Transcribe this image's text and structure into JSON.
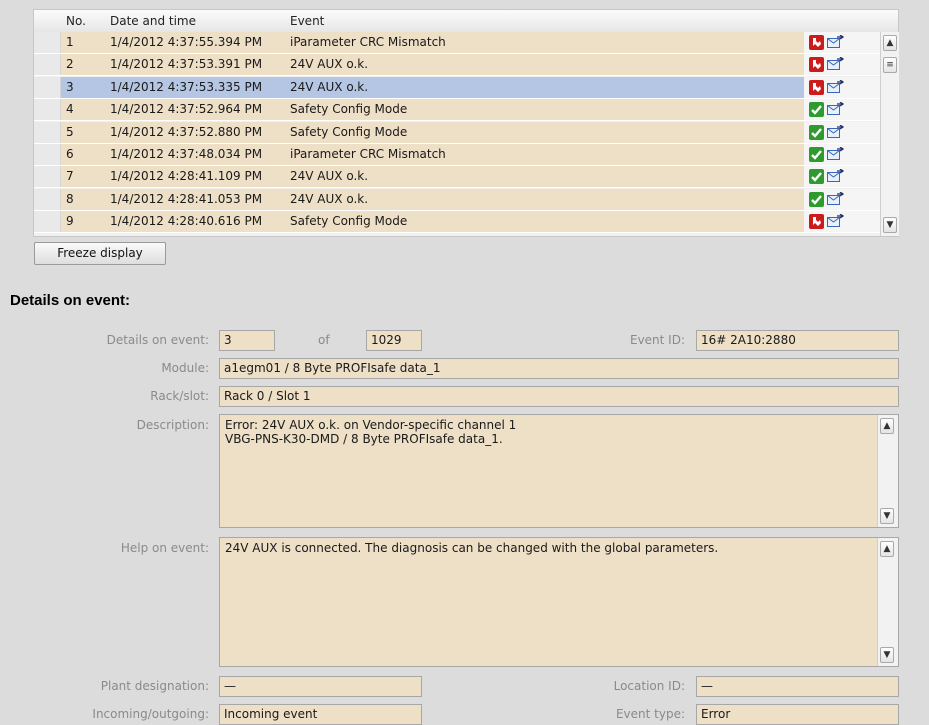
{
  "table": {
    "headers": {
      "no": "No.",
      "datetime": "Date and time",
      "event": "Event"
    },
    "rows": [
      {
        "no": "1",
        "datetime": "1/4/2012 4:37:55.394 PM",
        "event": "iParameter CRC Mismatch",
        "status": "error"
      },
      {
        "no": "2",
        "datetime": "1/4/2012 4:37:53.391 PM",
        "event": "24V AUX o.k.",
        "status": "error"
      },
      {
        "no": "3",
        "datetime": "1/4/2012 4:37:53.335 PM",
        "event": "24V AUX o.k.",
        "status": "error",
        "selected": true
      },
      {
        "no": "4",
        "datetime": "1/4/2012 4:37:52.964 PM",
        "event": "Safety Config Mode",
        "status": "ok"
      },
      {
        "no": "5",
        "datetime": "1/4/2012 4:37:52.880 PM",
        "event": "Safety Config Mode",
        "status": "ok"
      },
      {
        "no": "6",
        "datetime": "1/4/2012 4:37:48.034 PM",
        "event": "iParameter CRC Mismatch",
        "status": "ok"
      },
      {
        "no": "7",
        "datetime": "1/4/2012 4:28:41.109 PM",
        "event": "24V AUX o.k.",
        "status": "ok"
      },
      {
        "no": "8",
        "datetime": "1/4/2012 4:28:41.053 PM",
        "event": "24V AUX o.k.",
        "status": "ok"
      },
      {
        "no": "9",
        "datetime": "1/4/2012 4:28:40.616 PM",
        "event": "Safety Config Mode",
        "status": "error"
      }
    ]
  },
  "freeze_button": "Freeze display",
  "details": {
    "heading": "Details on event:",
    "details_on_event_label": "Details on event:",
    "event_index": "3",
    "of_label": "of",
    "event_total": "1029",
    "event_id_label": "Event ID:",
    "event_id": "16# 2A10:2880",
    "module_label": "Module:",
    "module": "a1egm01 / 8 Byte PROFIsafe data_1",
    "rack_slot_label": "Rack/slot:",
    "rack_slot": "Rack 0 / Slot 1",
    "description_label": "Description:",
    "description": "Error: 24V AUX o.k. on Vendor-specific channel 1\n VBG-PNS-K30-DMD / 8 Byte PROFIsafe data_1.",
    "help_label": "Help on event:",
    "help": "24V AUX is connected. The diagnosis can be changed with the global parameters.",
    "plant_designation_label": "Plant designation:",
    "plant_designation": "—",
    "location_id_label": "Location ID:",
    "location_id": "—",
    "incoming_outgoing_label": "Incoming/outgoing:",
    "incoming_outgoing": "Incoming event",
    "event_type_label": "Event type:",
    "event_type": "Error"
  },
  "colors": {
    "field_bg": "#eedfc7",
    "selected_row": "#b4c6e3",
    "error_icon": "#cc1b1b",
    "ok_icon": "#2e9b2e"
  }
}
